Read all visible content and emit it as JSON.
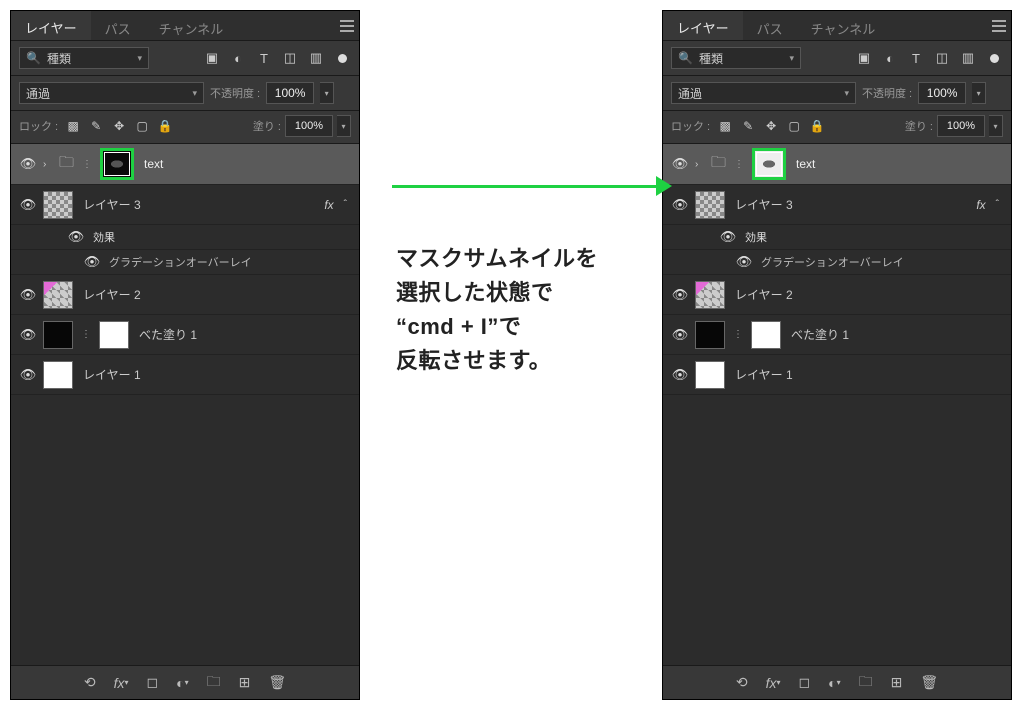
{
  "tabs": {
    "layers": "レイヤー",
    "paths": "パス",
    "channels": "チャンネル"
  },
  "filter": {
    "kind_label": "種類"
  },
  "blend": {
    "mode": "通過",
    "opacity_label": "不透明度 :",
    "opacity_value": "100%"
  },
  "lock": {
    "label": "ロック :",
    "fill_label": "塗り :",
    "fill_value": "100%"
  },
  "layers": {
    "text": {
      "name": "text"
    },
    "layer3": {
      "name": "レイヤー 3"
    },
    "effects_label": "効果",
    "effect_gradient": "グラデーションオーバーレイ",
    "layer2": {
      "name": "レイヤー 2"
    },
    "solid1": {
      "name": "べた塗り 1"
    },
    "layer1": {
      "name": "レイヤー 1"
    },
    "fx": "fx"
  },
  "caption": {
    "l1": "マスクサムネイルを",
    "l2": "選択した状態で",
    "l3": "“cmd + I”で",
    "l4": "反転させます。"
  }
}
